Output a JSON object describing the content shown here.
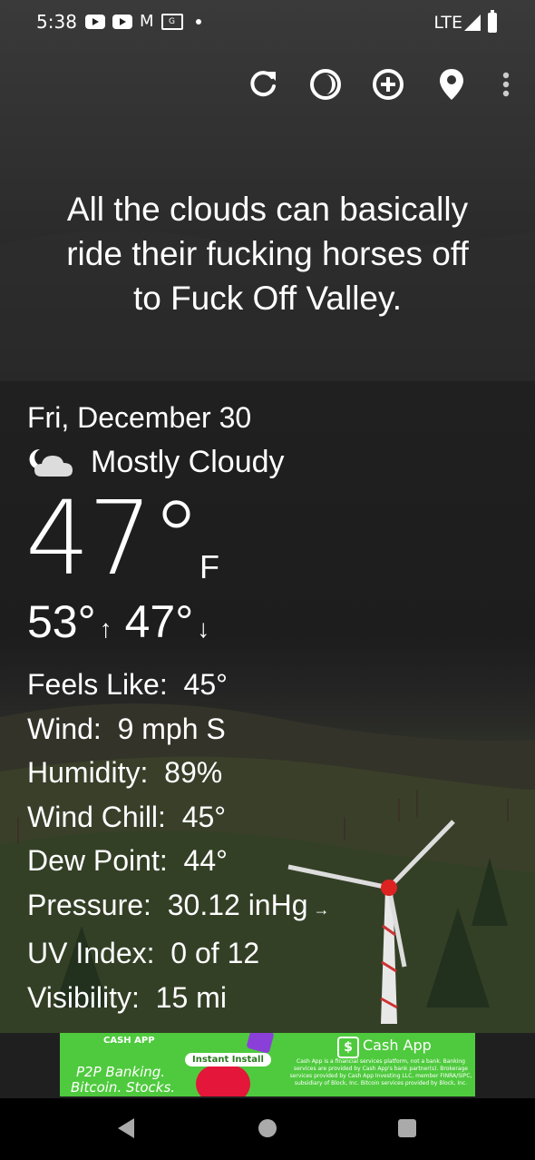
{
  "status_bar": {
    "time": "5:38",
    "network": "LTE",
    "notification_icons": [
      "youtube-icon",
      "youtube-icon",
      "gmail-icon",
      "news-icon",
      "dot-icon"
    ]
  },
  "toolbar": {
    "icons": [
      "refresh-icon",
      "theme-icon",
      "add-location-icon",
      "location-pin-icon",
      "more-vert-icon"
    ]
  },
  "quote": {
    "line1": "All the clouds can basically",
    "line2": "ride their fucking horses off",
    "line3": "to Fuck Off Valley."
  },
  "weather": {
    "date": "Fri, December 30",
    "condition": "Mostly Cloudy",
    "condition_icon": "night-cloudy-icon",
    "temperature": "47°",
    "unit": "F",
    "high": "53°",
    "high_arrow": "↑",
    "low": "47°",
    "low_arrow": "↓",
    "details": [
      {
        "label": "Feels Like:",
        "value": "45°"
      },
      {
        "label": "Wind:",
        "value": "9 mph S"
      },
      {
        "label": "Humidity:",
        "value": "89%"
      },
      {
        "label": "Wind Chill:",
        "value": "45°"
      },
      {
        "label": "Dew Point:",
        "value": "44°"
      },
      {
        "label": "Pressure:",
        "value": "30.12 inHg",
        "trend": "→"
      },
      {
        "label": "UV Index:",
        "value": "0 of 12"
      },
      {
        "label": "Visibility:",
        "value": "15 mi"
      }
    ]
  },
  "ad": {
    "brand_small": "CASH APP",
    "tagline1": "P2P Banking.",
    "tagline2": "Bitcoin. Stocks.",
    "install_label": "Instant Install",
    "name": "Cash App",
    "logo_symbol": "$",
    "disclaimer": "Cash App is a financial services platform, not a bank. Banking services are provided by Cash App's bank partner(s). Brokerage services provided by Cash App Investing LLC, member FINRA/SIPC, subsidiary of Block, Inc. Bitcoin services provided by Block, Inc.",
    "accent_color": "#4fca3e"
  },
  "colors": {
    "background": "#1f1f1f",
    "text": "#ffffff"
  }
}
